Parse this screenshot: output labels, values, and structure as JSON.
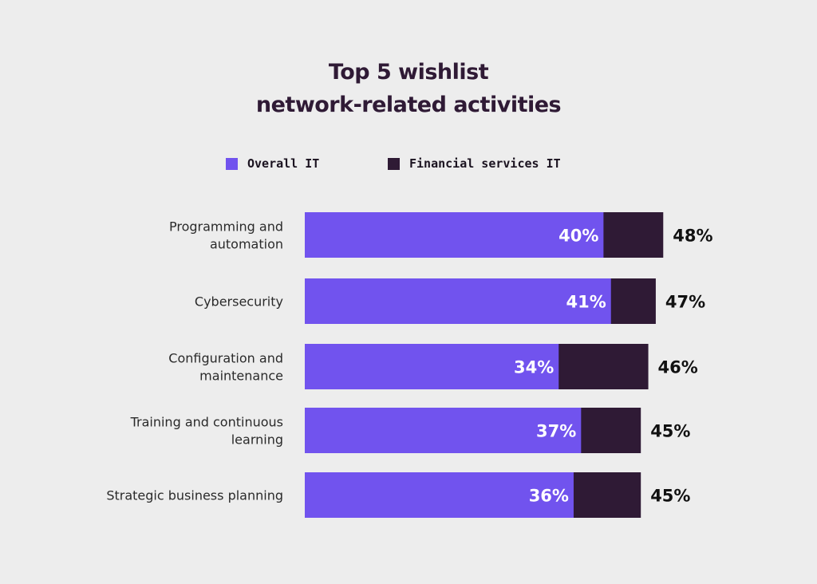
{
  "chart_data": {
    "type": "bar",
    "orientation": "horizontal",
    "overlap": true,
    "title": "Top 5 wishlist network-related activities",
    "title_lines": [
      "Top 5 wishlist",
      "network-related activities"
    ],
    "xlabel": "",
    "ylabel": "",
    "xlim": [
      0,
      48
    ],
    "grid": false,
    "legend_position": "top",
    "categories": [
      [
        "Programming and",
        "automation"
      ],
      [
        "Cybersecurity"
      ],
      [
        "Configuration and",
        "maintenance"
      ],
      [
        "Training and continuous",
        "learning"
      ],
      [
        "Strategic business planning"
      ]
    ],
    "series": [
      {
        "name": "Overall IT",
        "color": "#7153ee",
        "values": [
          40,
          41,
          34,
          37,
          36
        ]
      },
      {
        "name": "Financial services IT",
        "color": "#2f1a35",
        "values": [
          48,
          47,
          46,
          45,
          45
        ]
      }
    ],
    "value_suffix": "%"
  }
}
